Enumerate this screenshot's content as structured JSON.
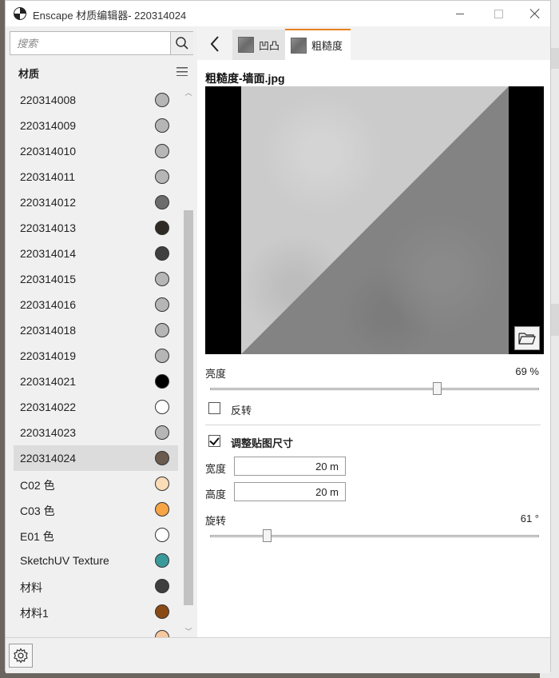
{
  "window": {
    "title": "Enscape 材质编辑器- 220314024"
  },
  "search": {
    "placeholder": "搜索"
  },
  "materials_panel": {
    "title": "材质",
    "items": [
      {
        "name": "220314008",
        "color": "#b6b6b6"
      },
      {
        "name": "220314009",
        "color": "#b6b6b6"
      },
      {
        "name": "220314010",
        "color": "#b6b6b6"
      },
      {
        "name": "220314011",
        "color": "#b6b6b6"
      },
      {
        "name": "220314012",
        "color": "#6c6c6c"
      },
      {
        "name": "220314013",
        "color": "#2f2b24"
      },
      {
        "name": "220314014",
        "color": "#3f3f3f"
      },
      {
        "name": "220314015",
        "color": "#b6b6b6"
      },
      {
        "name": "220314016",
        "color": "#b6b6b6"
      },
      {
        "name": "220314018",
        "color": "#b6b6b6"
      },
      {
        "name": "220314019",
        "color": "#b6b6b6"
      },
      {
        "name": "220314021",
        "color": "#000000"
      },
      {
        "name": "220314022",
        "color": "#ffffff"
      },
      {
        "name": "220314023",
        "color": "#b6b6b6"
      },
      {
        "name": "220314024",
        "color": "#6b5a4e",
        "selected": true
      },
      {
        "name": "C02 色",
        "color": "#fadcb6"
      },
      {
        "name": "C03 色",
        "color": "#f6a446"
      },
      {
        "name": "E01 色",
        "color": "#ffffff"
      },
      {
        "name": "SketchUV Texture",
        "color": "#3a9a9a"
      },
      {
        "name": "材料",
        "color": "#3f3f3f"
      },
      {
        "name": "材料1",
        "color": "#8a4a16"
      },
      {
        "name": "",
        "color": "#f6c8a0"
      }
    ]
  },
  "tabs": [
    {
      "label": "凹凸"
    },
    {
      "label": "粗糙度"
    }
  ],
  "texture": {
    "filename": "粗糙度-墙面.jpg"
  },
  "brightness": {
    "label": "亮度",
    "value": "69 %",
    "fraction": 0.69
  },
  "invert": {
    "label": "反转",
    "checked": false
  },
  "resize": {
    "label": "调整贴图尺寸",
    "checked": true,
    "width_label": "宽度",
    "width_value": "20  m",
    "height_label": "高度",
    "height_value": "20  m"
  },
  "rotation": {
    "label": "旋转",
    "value": "61 °",
    "fraction": 0.17
  },
  "colors": {
    "tab_accent": "#e8821e",
    "selected_row": "#dcdcdc"
  }
}
